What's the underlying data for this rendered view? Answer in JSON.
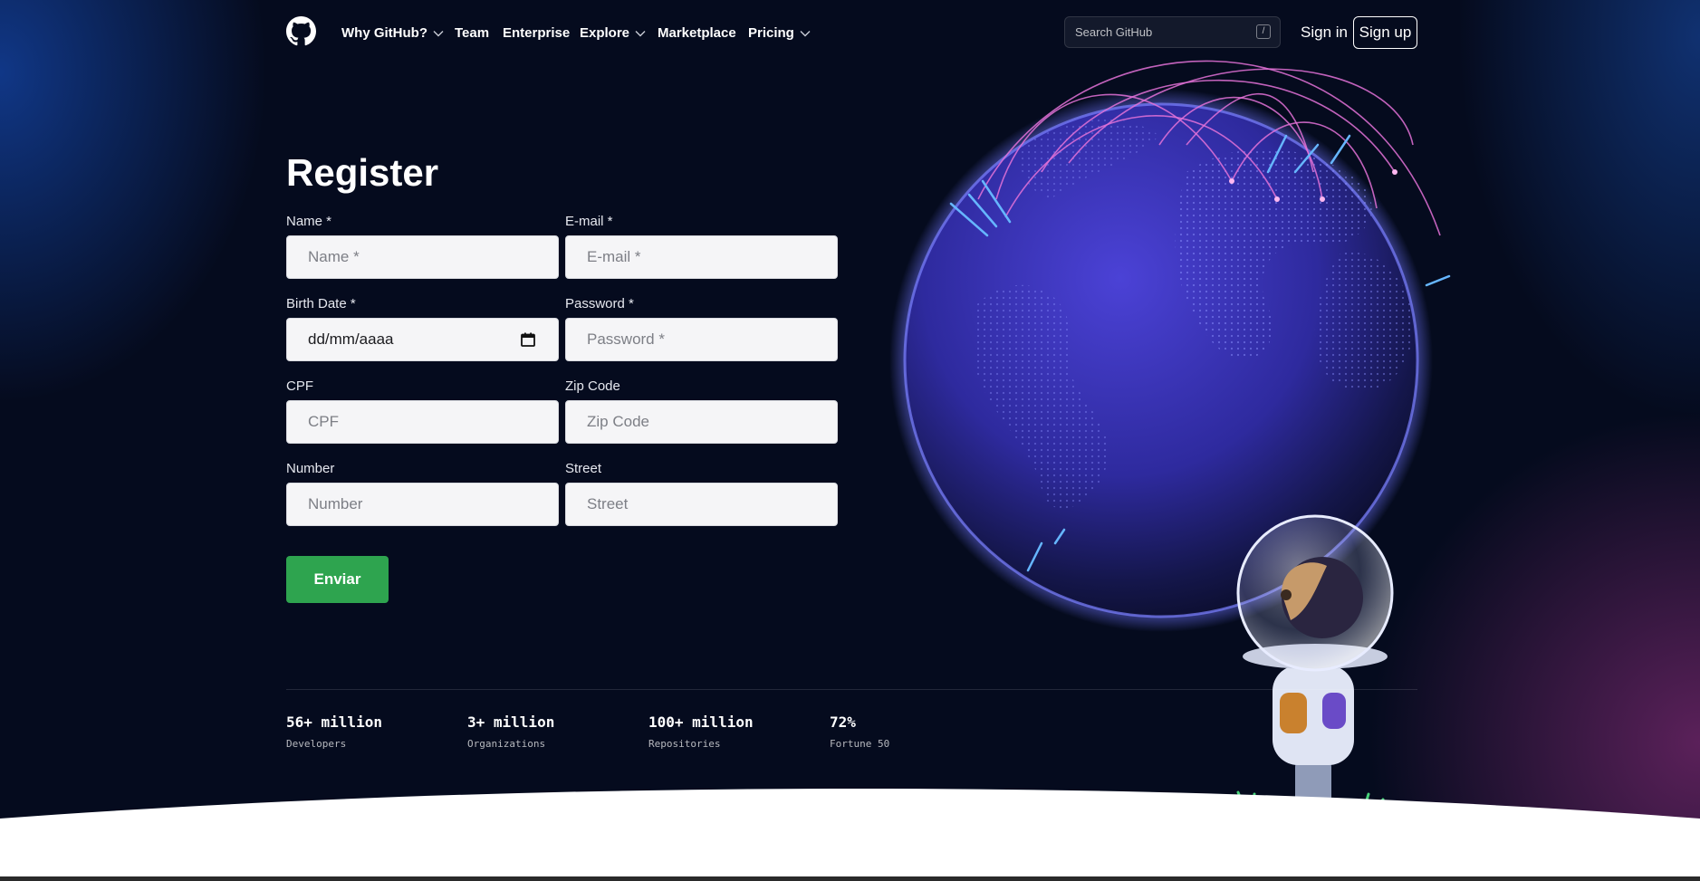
{
  "nav": {
    "items": [
      {
        "label": "Why GitHub?",
        "has_dropdown": true
      },
      {
        "label": "Team",
        "has_dropdown": false
      },
      {
        "label": "Enterprise",
        "has_dropdown": false
      },
      {
        "label": "Explore",
        "has_dropdown": true
      },
      {
        "label": "Marketplace",
        "has_dropdown": false
      },
      {
        "label": "Pricing",
        "has_dropdown": true
      }
    ],
    "search_placeholder": "Search GitHub",
    "search_shortcut": "/",
    "sign_in": "Sign in",
    "sign_up": "Sign up",
    "logo_icon": "github-octocat-icon"
  },
  "form": {
    "title": "Register",
    "name": {
      "label": "Name *",
      "placeholder": "Name *"
    },
    "email": {
      "label": "E-mail *",
      "placeholder": "E-mail *"
    },
    "birth_date": {
      "label": "Birth Date *",
      "value": "dd/mm/aaaa",
      "icon": "calendar-icon"
    },
    "password": {
      "label": "Password *",
      "placeholder": "Password *"
    },
    "cpf": {
      "label": "CPF",
      "placeholder": "CPF"
    },
    "zip_code": {
      "label": "Zip Code",
      "placeholder": "Zip Code"
    },
    "number": {
      "label": "Number",
      "placeholder": "Number"
    },
    "street": {
      "label": "Street",
      "placeholder": "Street"
    },
    "submit_label": "Enviar"
  },
  "stats": [
    {
      "value": "56+ million",
      "label": "Developers"
    },
    {
      "value": "3+ million",
      "label": "Organizations"
    },
    {
      "value": "100+ million",
      "label": "Repositories"
    },
    {
      "value": "72%",
      "label": "Fortune 50"
    }
  ],
  "colors": {
    "background": "#050b1e",
    "submit_button": "#2ea44f",
    "input_background": "#f5f5f7",
    "globe": "#3a36c9",
    "arc": "#e472d8"
  }
}
